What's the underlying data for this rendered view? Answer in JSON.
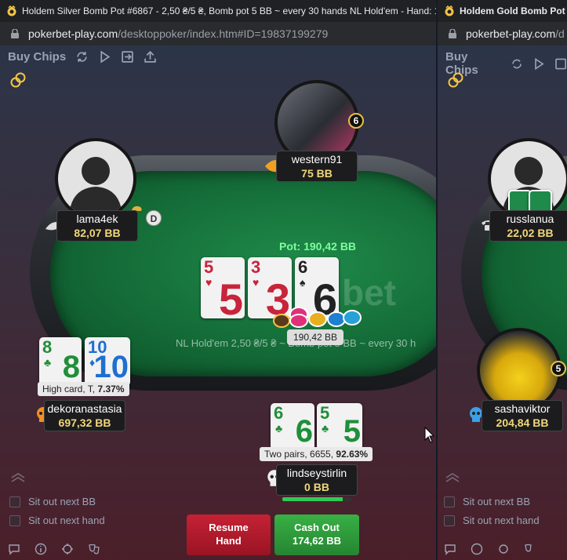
{
  "window1": {
    "tab_title": "Holdem Silver Bomb Pot #6867 - 2,50 ₴/5 ₴, Bomb pot 5 BB ~ every 30 hands NL Hold'em - Hand: 1",
    "url_host": "pokerbet-play.com",
    "url_path": "/desktoppoker/index.htm#ID=19837199279",
    "toolbar": {
      "buy_chips": "Buy Chips"
    },
    "table_info": "NL Hold'em 2,50 ₴/5 ₴ ~ Bomb pot 5 BB ~ every 30 h",
    "watermark": "bet",
    "pot_label": "Pot: 190,42 BB",
    "pot_amount": "190,42 BB",
    "board": [
      {
        "rank": "5",
        "suit": "♥",
        "color": "red"
      },
      {
        "rank": "3",
        "suit": "♥",
        "color": "red"
      },
      {
        "rank": "6",
        "suit": "♠",
        "color": "blk"
      }
    ],
    "players": {
      "western91": {
        "name": "western91",
        "stack": "75 BB",
        "level": "6"
      },
      "lama4ek": {
        "name": "lama4ek",
        "stack": "82,07 BB",
        "dealer": "D"
      },
      "dekoranastasia": {
        "name": "dekoranastasia",
        "stack": "697,32 BB",
        "hand_desc": "High card, T, ",
        "hand_pct": "7.37%",
        "cards": [
          {
            "rank": "8",
            "suit": "♣",
            "color": "grn"
          },
          {
            "rank": "10",
            "suit": "♦",
            "color": "blu"
          }
        ]
      },
      "lindseystirlin": {
        "name": "lindseystirlin",
        "stack": "0 BB",
        "hand_desc": "Two pairs, 6655, ",
        "hand_pct": "92.63%",
        "cards": [
          {
            "rank": "6",
            "suit": "♣",
            "color": "grn"
          },
          {
            "rank": "5",
            "suit": "♣",
            "color": "grn"
          }
        ],
        "timer_fraction": 0.88
      }
    },
    "options": {
      "sit_out_next_bb": "Sit out next BB",
      "sit_out_next_hand": "Sit out next hand"
    },
    "buttons": {
      "resume_line1": "Resume",
      "resume_line2": "Hand",
      "cashout_line1": "Cash Out",
      "cashout_line2": "174,62 BB"
    }
  },
  "window2": {
    "tab_title": "Holdem Gold Bomb Pot #1",
    "url_host": "pokerbet-play.com",
    "url_path": "/d",
    "toolbar": {
      "buy_chips": "Buy Chips"
    },
    "players": {
      "russlanua": {
        "name": "russlanua",
        "stack": "22,02 BB"
      },
      "sashaviktor": {
        "name": "sashaviktor",
        "stack": "204,84 BB",
        "level": "5"
      }
    },
    "options": {
      "sit_out_next_bb": "Sit out next BB",
      "sit_out_next_hand": "Sit out next hand"
    }
  },
  "colors": {
    "pot_green": "#7dff9a",
    "stack_gold": "#f1d77a",
    "resume_red": "#b81c2c",
    "cashout_green": "#2f9a3a"
  }
}
